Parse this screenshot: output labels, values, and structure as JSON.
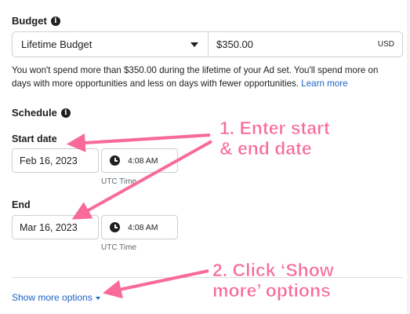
{
  "budget": {
    "title": "Budget",
    "type_value": "Lifetime Budget",
    "amount_value": "$350.00",
    "currency": "USD",
    "helper_text": "You won't spend more than $350.00 during the lifetime of your Ad set. You'll spend more on days with more opportunities and less on days with fewer opportunities.",
    "learn_more": "Learn more"
  },
  "schedule": {
    "title": "Schedule",
    "start": {
      "label": "Start date",
      "date": "Feb 16, 2023",
      "time": "4:08 AM",
      "timezone": "UTC Time"
    },
    "end": {
      "label": "End",
      "date": "Mar 16, 2023",
      "time": "4:08 AM",
      "timezone": "UTC Time"
    }
  },
  "show_more": {
    "label": "Show more options"
  },
  "annotations": {
    "step1_line1": "1. Enter start",
    "step1_line2": "& end date",
    "step2_line1": "2. Click ‘Show",
    "step2_line2": "more’ options",
    "color": "#f76a9b"
  },
  "colors": {
    "link": "#1d63c6",
    "border": "#ccd0d5",
    "text": "#1c1e21"
  },
  "icons": {
    "info": "info-icon",
    "clock": "clock-icon",
    "dropdown": "chevron-down-icon"
  }
}
